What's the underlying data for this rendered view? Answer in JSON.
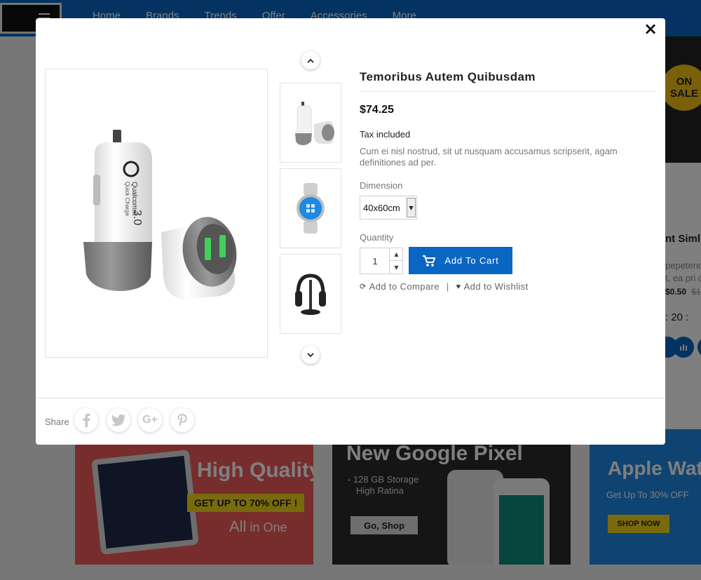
{
  "background": {
    "nav": [
      "Home",
      "Brands",
      "Trends",
      "Offer",
      "Accessories",
      "More"
    ],
    "sale_badge": [
      "ON",
      "SALE"
    ],
    "side_product": {
      "title": "nt Simli",
      "desc_line1": "pepetendis",
      "desc_line2": "t, ea pri c",
      "price": "$0.50",
      "old_price": "$1",
      "timer": ":  20  :"
    },
    "promo1": {
      "title": "High Quality",
      "tag": "GET UP TO 70% OFF !",
      "tagline_big": "All",
      "tagline_small": " in One"
    },
    "promo2": {
      "title": "New Google Pixel",
      "sub1": "- 128 GB Storage",
      "sub2": "High Ratina",
      "button": "Go, Shop"
    },
    "promo3": {
      "title": "Apple Watch",
      "sub": "Get Up To 30% OFF",
      "button": "SHOP NOW"
    }
  },
  "modal": {
    "close": "×",
    "title": "Temoribus Autem Quibusdam",
    "price": "$74.25",
    "tax": "Tax included",
    "description": "Cum ei nisl nostrud, sit ut nusquam accusamus scripserit, agam definitiones ad per.",
    "dimension_label": "Dimension",
    "dimension_value": "40x60cm",
    "quantity_label": "Quantity",
    "quantity_value": "1",
    "add_to_cart": "Add To Cart",
    "compare": "Add to Compare",
    "separator": "|",
    "wishlist": "Add to Wishlist",
    "share_label": "Share",
    "charger_brand": "Qualcomm",
    "charger_text": "Quick Charge",
    "charger_version": "3.0"
  },
  "colors": {
    "accent": "#0b66c3",
    "sale": "#f2c012"
  },
  "icons": {
    "close": "close-icon",
    "cart": "cart-icon",
    "compare": "refresh-icon",
    "wishlist": "heart-icon",
    "up": "chevron-up-icon",
    "down": "chevron-down-icon"
  }
}
